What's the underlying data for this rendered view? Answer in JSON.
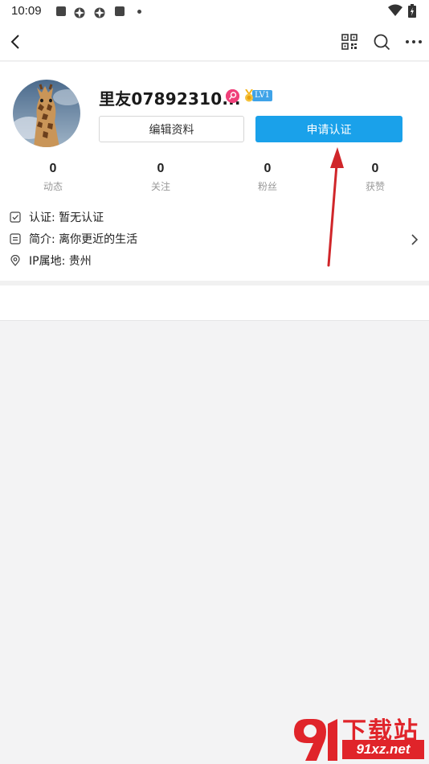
{
  "status_bar": {
    "time": "10:09"
  },
  "topbar": {
    "back_icon": "back-arrow-icon",
    "qr_icon": "qr-code-icon",
    "search_icon": "search-icon",
    "more_icon": "more-dots-icon"
  },
  "profile": {
    "username": "里友07892310...",
    "level_label": "LV1",
    "edit_button": "编辑资料",
    "apply_button": "申请认证",
    "stats": [
      {
        "value": "0",
        "label": "动态"
      },
      {
        "value": "0",
        "label": "关注"
      },
      {
        "value": "0",
        "label": "粉丝"
      },
      {
        "value": "0",
        "label": "获赞"
      }
    ],
    "info": {
      "verify": "认证: 暂无认证",
      "bio": "简介: 离你更近的生活",
      "ip": "IP属地: 贵州"
    }
  },
  "watermark": {
    "title": "下载站",
    "url": "91xz.net"
  },
  "colors": {
    "accent": "#1aa1ea",
    "annotation_arrow": "#d0262a",
    "watermark": "#e0242a"
  }
}
